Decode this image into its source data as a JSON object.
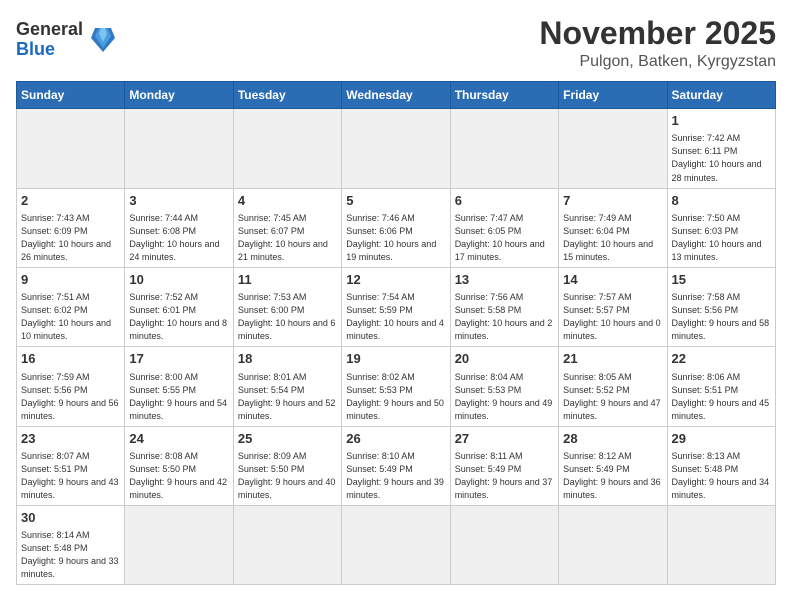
{
  "header": {
    "logo_general": "General",
    "logo_blue": "Blue",
    "month_title": "November 2025",
    "location": "Pulgon, Batken, Kyrgyzstan"
  },
  "days_of_week": [
    "Sunday",
    "Monday",
    "Tuesday",
    "Wednesday",
    "Thursday",
    "Friday",
    "Saturday"
  ],
  "weeks": [
    {
      "days": [
        {
          "num": "",
          "empty": true
        },
        {
          "num": "",
          "empty": true
        },
        {
          "num": "",
          "empty": true
        },
        {
          "num": "",
          "empty": true
        },
        {
          "num": "",
          "empty": true
        },
        {
          "num": "",
          "empty": true
        },
        {
          "num": "1",
          "info": "Sunrise: 7:42 AM\nSunset: 6:11 PM\nDaylight: 10 hours\nand 28 minutes."
        }
      ]
    },
    {
      "days": [
        {
          "num": "2",
          "info": "Sunrise: 7:43 AM\nSunset: 6:09 PM\nDaylight: 10 hours\nand 26 minutes."
        },
        {
          "num": "3",
          "info": "Sunrise: 7:44 AM\nSunset: 6:08 PM\nDaylight: 10 hours\nand 24 minutes."
        },
        {
          "num": "4",
          "info": "Sunrise: 7:45 AM\nSunset: 6:07 PM\nDaylight: 10 hours\nand 21 minutes."
        },
        {
          "num": "5",
          "info": "Sunrise: 7:46 AM\nSunset: 6:06 PM\nDaylight: 10 hours\nand 19 minutes."
        },
        {
          "num": "6",
          "info": "Sunrise: 7:47 AM\nSunset: 6:05 PM\nDaylight: 10 hours\nand 17 minutes."
        },
        {
          "num": "7",
          "info": "Sunrise: 7:49 AM\nSunset: 6:04 PM\nDaylight: 10 hours\nand 15 minutes."
        },
        {
          "num": "8",
          "info": "Sunrise: 7:50 AM\nSunset: 6:03 PM\nDaylight: 10 hours\nand 13 minutes."
        }
      ]
    },
    {
      "days": [
        {
          "num": "9",
          "info": "Sunrise: 7:51 AM\nSunset: 6:02 PM\nDaylight: 10 hours\nand 10 minutes."
        },
        {
          "num": "10",
          "info": "Sunrise: 7:52 AM\nSunset: 6:01 PM\nDaylight: 10 hours\nand 8 minutes."
        },
        {
          "num": "11",
          "info": "Sunrise: 7:53 AM\nSunset: 6:00 PM\nDaylight: 10 hours\nand 6 minutes."
        },
        {
          "num": "12",
          "info": "Sunrise: 7:54 AM\nSunset: 5:59 PM\nDaylight: 10 hours\nand 4 minutes."
        },
        {
          "num": "13",
          "info": "Sunrise: 7:56 AM\nSunset: 5:58 PM\nDaylight: 10 hours\nand 2 minutes."
        },
        {
          "num": "14",
          "info": "Sunrise: 7:57 AM\nSunset: 5:57 PM\nDaylight: 10 hours\nand 0 minutes."
        },
        {
          "num": "15",
          "info": "Sunrise: 7:58 AM\nSunset: 5:56 PM\nDaylight: 9 hours\nand 58 minutes."
        }
      ]
    },
    {
      "days": [
        {
          "num": "16",
          "info": "Sunrise: 7:59 AM\nSunset: 5:56 PM\nDaylight: 9 hours\nand 56 minutes."
        },
        {
          "num": "17",
          "info": "Sunrise: 8:00 AM\nSunset: 5:55 PM\nDaylight: 9 hours\nand 54 minutes."
        },
        {
          "num": "18",
          "info": "Sunrise: 8:01 AM\nSunset: 5:54 PM\nDaylight: 9 hours\nand 52 minutes."
        },
        {
          "num": "19",
          "info": "Sunrise: 8:02 AM\nSunset: 5:53 PM\nDaylight: 9 hours\nand 50 minutes."
        },
        {
          "num": "20",
          "info": "Sunrise: 8:04 AM\nSunset: 5:53 PM\nDaylight: 9 hours\nand 49 minutes."
        },
        {
          "num": "21",
          "info": "Sunrise: 8:05 AM\nSunset: 5:52 PM\nDaylight: 9 hours\nand 47 minutes."
        },
        {
          "num": "22",
          "info": "Sunrise: 8:06 AM\nSunset: 5:51 PM\nDaylight: 9 hours\nand 45 minutes."
        }
      ]
    },
    {
      "days": [
        {
          "num": "23",
          "info": "Sunrise: 8:07 AM\nSunset: 5:51 PM\nDaylight: 9 hours\nand 43 minutes."
        },
        {
          "num": "24",
          "info": "Sunrise: 8:08 AM\nSunset: 5:50 PM\nDaylight: 9 hours\nand 42 minutes."
        },
        {
          "num": "25",
          "info": "Sunrise: 8:09 AM\nSunset: 5:50 PM\nDaylight: 9 hours\nand 40 minutes."
        },
        {
          "num": "26",
          "info": "Sunrise: 8:10 AM\nSunset: 5:49 PM\nDaylight: 9 hours\nand 39 minutes."
        },
        {
          "num": "27",
          "info": "Sunrise: 8:11 AM\nSunset: 5:49 PM\nDaylight: 9 hours\nand 37 minutes."
        },
        {
          "num": "28",
          "info": "Sunrise: 8:12 AM\nSunset: 5:49 PM\nDaylight: 9 hours\nand 36 minutes."
        },
        {
          "num": "29",
          "info": "Sunrise: 8:13 AM\nSunset: 5:48 PM\nDaylight: 9 hours\nand 34 minutes."
        }
      ]
    },
    {
      "days": [
        {
          "num": "30",
          "info": "Sunrise: 8:14 AM\nSunset: 5:48 PM\nDaylight: 9 hours\nand 33 minutes."
        },
        {
          "num": "",
          "empty": true
        },
        {
          "num": "",
          "empty": true
        },
        {
          "num": "",
          "empty": true
        },
        {
          "num": "",
          "empty": true
        },
        {
          "num": "",
          "empty": true
        },
        {
          "num": "",
          "empty": true
        }
      ]
    }
  ]
}
